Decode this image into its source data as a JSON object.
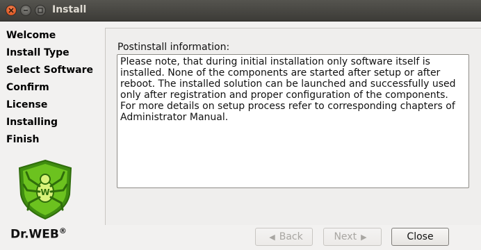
{
  "window": {
    "title": "Install",
    "controls": [
      "close-icon",
      "minimize-icon",
      "maximize-icon"
    ]
  },
  "sidebar": {
    "steps": [
      {
        "label": "Welcome"
      },
      {
        "label": "Install Type"
      },
      {
        "label": "Select Software"
      },
      {
        "label": "Confirm"
      },
      {
        "label": "License"
      },
      {
        "label": "Installing"
      },
      {
        "label": "Finish"
      }
    ],
    "brand": "Dr.WEB",
    "brand_mark": "®"
  },
  "main": {
    "info_label": "Postinstall information:",
    "info_text": "Please note, that during initial installation only software itself is\ninstalled. None of the components are started after setup or after\nreboot. The installed solution can be launched and successfully used\nonly after registration and proper configuration of the components.\nFor more details on setup process refer to corresponding chapters of\nAdministrator Manual."
  },
  "buttons": {
    "back": "Back",
    "next": "Next",
    "close": "Close"
  },
  "colors": {
    "titlebar": "#3c3b37",
    "close_button": "#e15e2a",
    "logo_green": "#5cb31a"
  }
}
